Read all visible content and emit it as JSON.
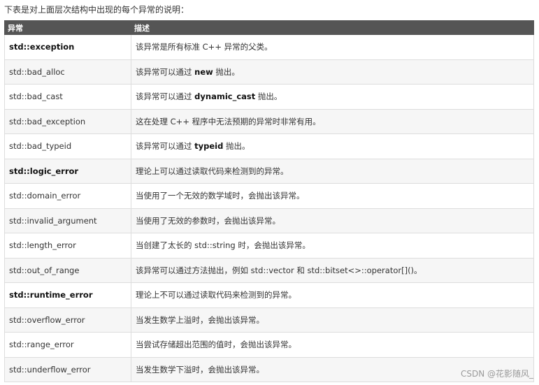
{
  "intro": "下表是对上面层次结构中出现的每个异常的说明：",
  "table": {
    "headers": [
      "异常",
      "描述"
    ],
    "rows": [
      {
        "name": "std::exception",
        "bold": true,
        "desc_pre": "该异常是所有标准 C++ 异常的父类。",
        "desc_kw": "",
        "desc_post": ""
      },
      {
        "name": "std::bad_alloc",
        "bold": false,
        "desc_pre": "该异常可以通过 ",
        "desc_kw": "new",
        "desc_post": " 抛出。"
      },
      {
        "name": "std::bad_cast",
        "bold": false,
        "desc_pre": "该异常可以通过 ",
        "desc_kw": "dynamic_cast",
        "desc_post": " 抛出。"
      },
      {
        "name": "std::bad_exception",
        "bold": false,
        "desc_pre": "这在处理 C++ 程序中无法预期的异常时非常有用。",
        "desc_kw": "",
        "desc_post": ""
      },
      {
        "name": "std::bad_typeid",
        "bold": false,
        "desc_pre": "该异常可以通过 ",
        "desc_kw": "typeid",
        "desc_post": " 抛出。"
      },
      {
        "name": "std::logic_error",
        "bold": true,
        "desc_pre": "理论上可以通过读取代码来检测到的异常。",
        "desc_kw": "",
        "desc_post": ""
      },
      {
        "name": "std::domain_error",
        "bold": false,
        "desc_pre": "当使用了一个无效的数学域时，会抛出该异常。",
        "desc_kw": "",
        "desc_post": ""
      },
      {
        "name": "std::invalid_argument",
        "bold": false,
        "desc_pre": "当使用了无效的参数时，会抛出该异常。",
        "desc_kw": "",
        "desc_post": ""
      },
      {
        "name": "std::length_error",
        "bold": false,
        "desc_pre": "当创建了太长的 std::string 时，会抛出该异常。",
        "desc_kw": "",
        "desc_post": ""
      },
      {
        "name": "std::out_of_range",
        "bold": false,
        "desc_pre": "该异常可以通过方法抛出，例如 std::vector 和 std::bitset<>::operator[]()。",
        "desc_kw": "",
        "desc_post": ""
      },
      {
        "name": "std::runtime_error",
        "bold": true,
        "desc_pre": "理论上不可以通过读取代码来检测到的异常。",
        "desc_kw": "",
        "desc_post": ""
      },
      {
        "name": "std::overflow_error",
        "bold": false,
        "desc_pre": "当发生数学上溢时，会抛出该异常。",
        "desc_kw": "",
        "desc_post": ""
      },
      {
        "name": "std::range_error",
        "bold": false,
        "desc_pre": "当尝试存储超出范围的值时，会抛出该异常。",
        "desc_kw": "",
        "desc_post": ""
      },
      {
        "name": "std::underflow_error",
        "bold": false,
        "desc_pre": "当发生数学下溢时，会抛出该异常。",
        "desc_kw": "",
        "desc_post": ""
      }
    ]
  },
  "watermark": "CSDN @花影随风_"
}
